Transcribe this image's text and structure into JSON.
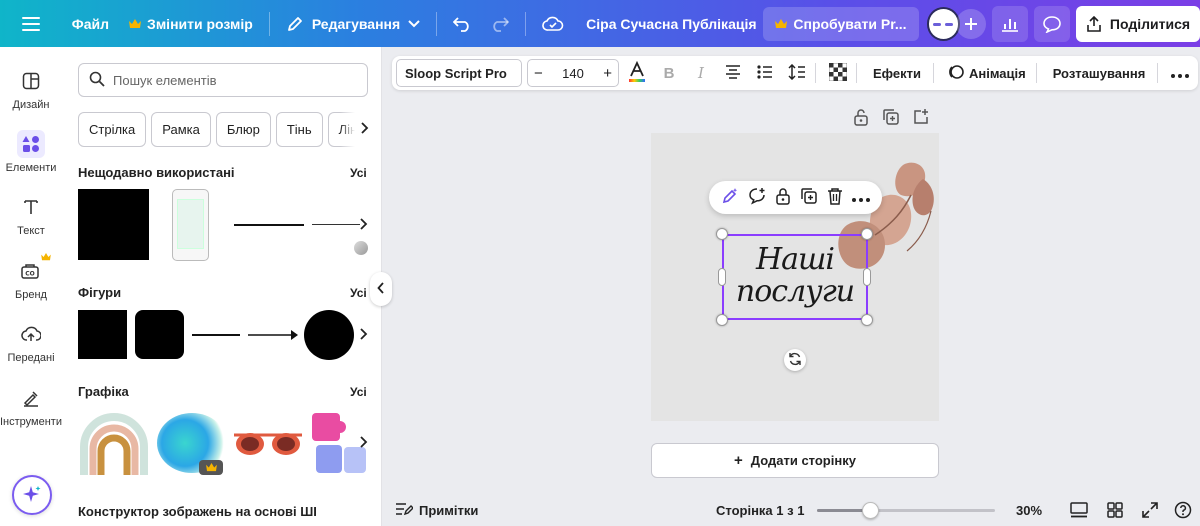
{
  "topbar": {
    "file": "Файл",
    "resize": "Змінити розмір",
    "edit": "Редагування",
    "doc_title": "Сіра Сучасна Публікація ...",
    "try_pro": "Спробувати Pr...",
    "share": "Поділитися"
  },
  "rail": {
    "items": [
      {
        "label": "Дизайн",
        "icon": "layout-icon"
      },
      {
        "label": "Елементи",
        "icon": "elements-icon"
      },
      {
        "label": "Текст",
        "icon": "text-icon"
      },
      {
        "label": "Бренд",
        "icon": "brand-icon"
      },
      {
        "label": "Передані",
        "icon": "uploads-icon"
      },
      {
        "label": "Інструменти",
        "icon": "tools-icon"
      }
    ]
  },
  "panel": {
    "search_placeholder": "Пошук елементів",
    "chips": [
      "Стрілка",
      "Рамка",
      "Блюр",
      "Тінь",
      "Лін"
    ],
    "sections": [
      {
        "title": "Нещодавно використані",
        "all": "Усі"
      },
      {
        "title": "Фігури",
        "all": "Усі"
      },
      {
        "title": "Графіка",
        "all": "Усі"
      },
      {
        "title": "Конструктор зображень на основі ШІ"
      }
    ]
  },
  "editor_toolbar": {
    "font": "Sloop Script Pro",
    "size": "140",
    "minus": "−",
    "plus": "+",
    "effects": "Ефекти",
    "animation": "Анімація",
    "position": "Розташування"
  },
  "canvas": {
    "text_line1": "Наші",
    "text_line2": "послуги",
    "add_page": "Додати сторінку",
    "add_page_plus": "+"
  },
  "footer": {
    "notes": "Примітки",
    "page_indicator": "Сторінка 1 з 1",
    "zoom": "30%",
    "zoom_fraction": 0.3
  },
  "colors": {
    "accent": "#8b3dff",
    "crown": "#f5b400",
    "topbar_start": "#0fb5c9",
    "topbar_end": "#7b3ee6"
  }
}
